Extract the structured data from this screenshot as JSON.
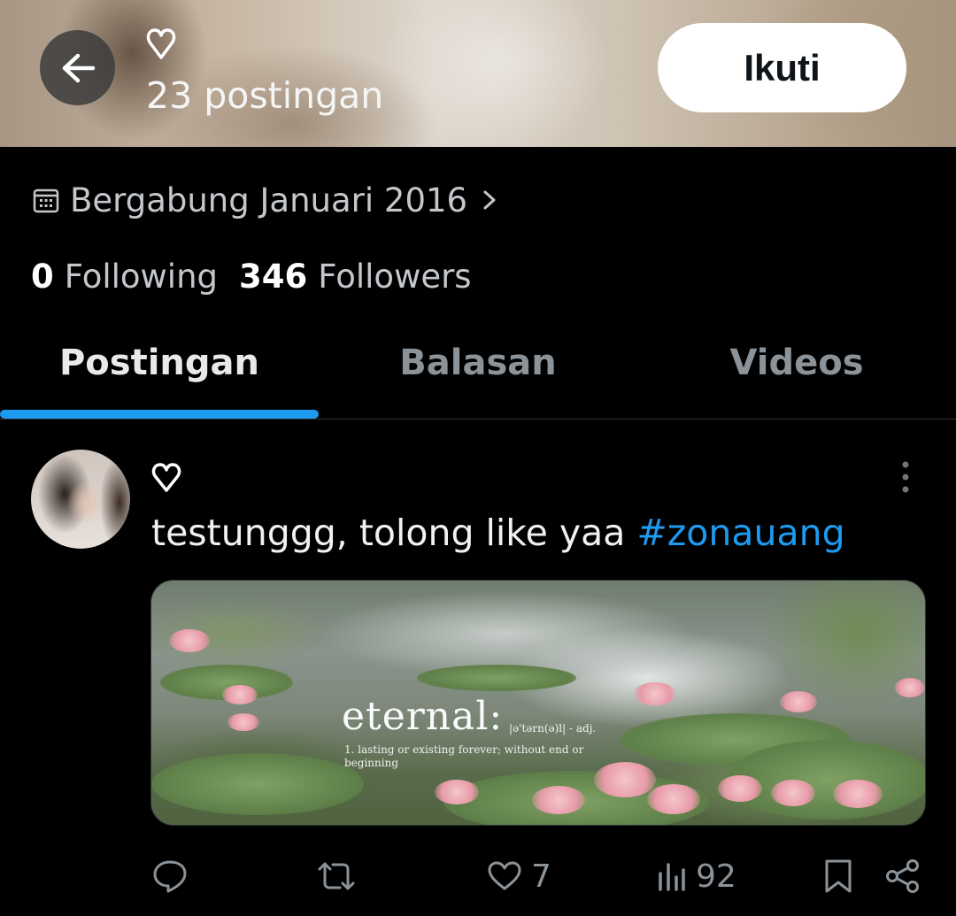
{
  "header": {
    "heart_glyph": "♡",
    "post_count": "23 postingan",
    "follow_label": "Ikuti"
  },
  "profile": {
    "joined": "Bergabung Januari 2016",
    "following_count": "0",
    "following_label": "Following",
    "followers_count": "346",
    "followers_label": "Followers"
  },
  "tabs": [
    {
      "label": "Postingan",
      "active": true
    },
    {
      "label": "Balasan",
      "active": false
    },
    {
      "label": "Videos",
      "active": false
    }
  ],
  "post": {
    "author_name_glyph": "♡",
    "text": "testunggg, tolong like yaa ",
    "hashtag": "#zonauang",
    "image": {
      "word": "eternal:",
      "pronunciation": "|ə'tərn(ə)l| - adj.",
      "definition": "1. lasting or existing forever; without end or beginning"
    },
    "actions": {
      "likes": "7",
      "views": "92"
    }
  },
  "colors": {
    "accent": "#1d9bf0",
    "background": "#000000",
    "muted_text": "#8b9298"
  }
}
